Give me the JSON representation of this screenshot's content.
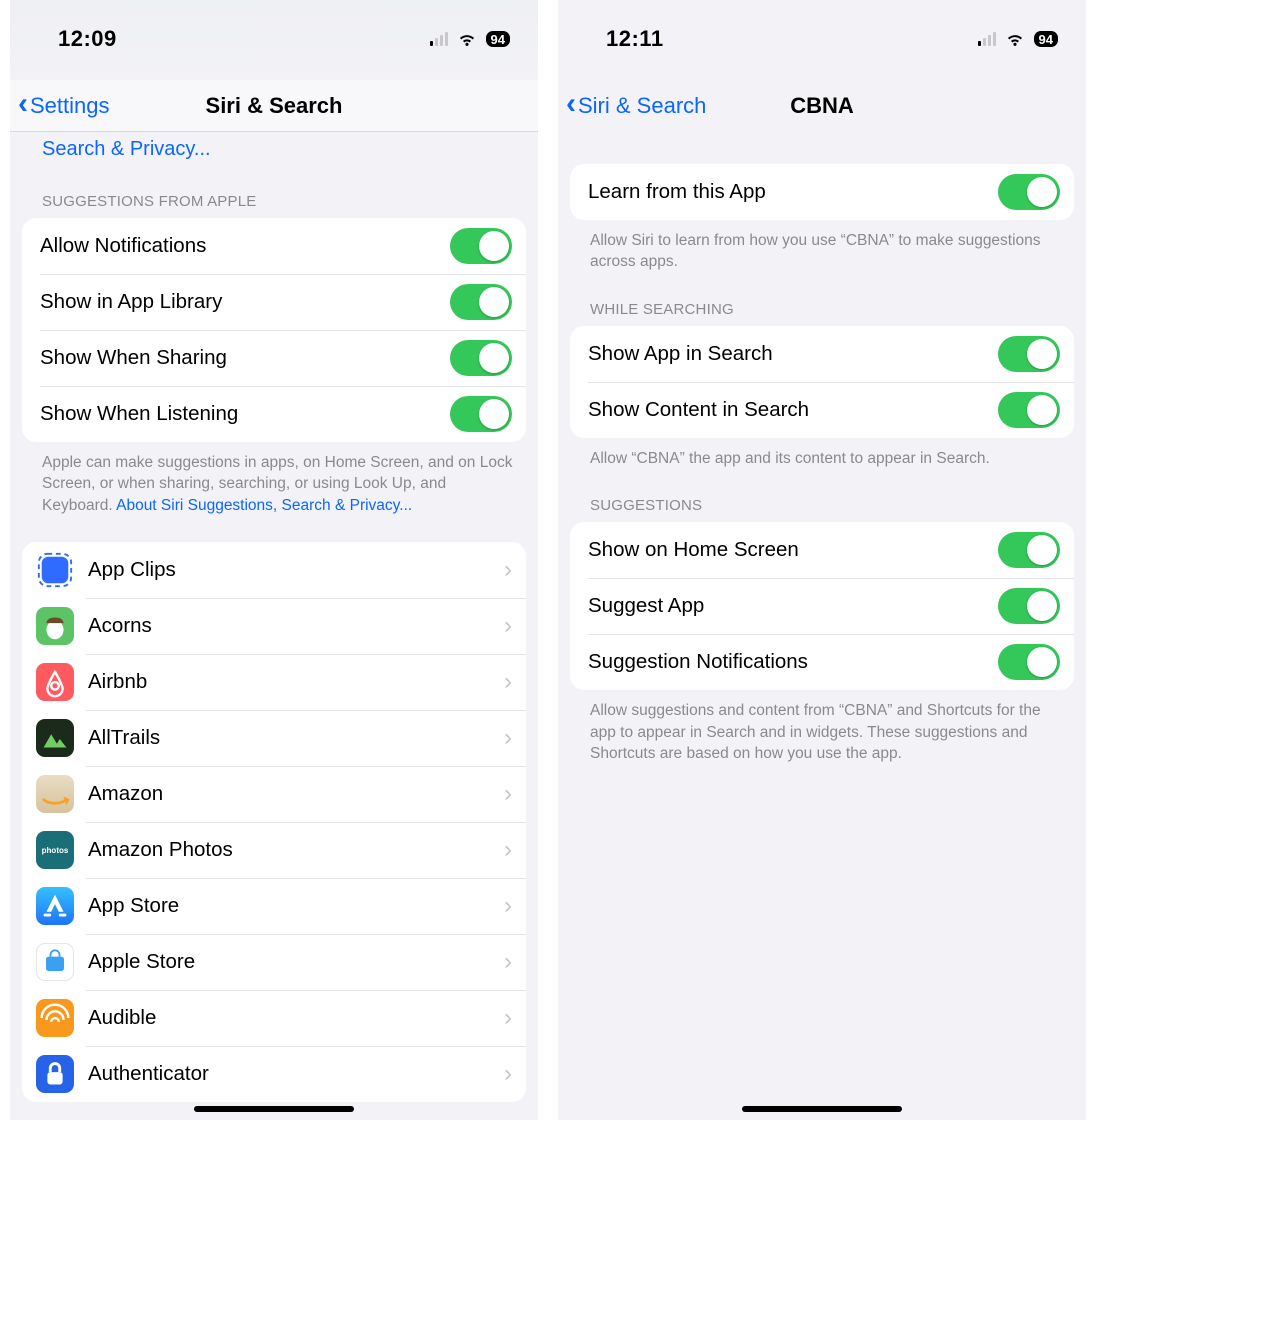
{
  "left": {
    "status": {
      "time": "12:09",
      "battery": "94"
    },
    "nav": {
      "back": "Settings",
      "title": "Siri & Search"
    },
    "top_link": "Search & Privacy...",
    "suggestions_header": "SUGGESTIONS FROM APPLE",
    "toggles": {
      "allow_notifications": "Allow Notifications",
      "show_app_library": "Show in App Library",
      "show_when_sharing": "Show When Sharing",
      "show_when_listening": "Show When Listening"
    },
    "suggestions_footer_pre": "Apple can make suggestions in apps, on Home Screen, and on Lock Screen, or when sharing, searching, or using Look Up, and Keyboard. ",
    "suggestions_footer_link": "About Siri Suggestions, Search & Privacy...",
    "apps": [
      {
        "name": "App Clips",
        "icon": "appclips"
      },
      {
        "name": "Acorns",
        "icon": "acorns"
      },
      {
        "name": "Airbnb",
        "icon": "airbnb"
      },
      {
        "name": "AllTrails",
        "icon": "alltrails"
      },
      {
        "name": "Amazon",
        "icon": "amazon"
      },
      {
        "name": "Amazon Photos",
        "icon": "amazonphotos"
      },
      {
        "name": "App Store",
        "icon": "appstore"
      },
      {
        "name": "Apple Store",
        "icon": "applestore"
      },
      {
        "name": "Audible",
        "icon": "audible"
      },
      {
        "name": "Authenticator",
        "icon": "auth"
      }
    ]
  },
  "right": {
    "status": {
      "time": "12:11",
      "battery": "94"
    },
    "nav": {
      "back": "Siri & Search",
      "title": "CBNA"
    },
    "learn_label": "Learn from this App",
    "learn_footer": "Allow Siri to learn from how you use “CBNA” to make suggestions across apps.",
    "while_searching_header": "WHILE SEARCHING",
    "search_toggles": {
      "show_app_in_search": "Show App in Search",
      "show_content_in_search": "Show Content in Search"
    },
    "search_footer": "Allow “CBNA” the app and its content to appear in Search.",
    "suggestions_header": "SUGGESTIONS",
    "suggestions_toggles": {
      "show_home": "Show on Home Screen",
      "suggest_app": "Suggest App",
      "suggestion_notifications": "Suggestion Notifications"
    },
    "suggestions_footer": "Allow suggestions and content from “CBNA” and Shortcuts for the app to appear in Search and in widgets. These suggestions and Shortcuts are based on how you use the app."
  }
}
